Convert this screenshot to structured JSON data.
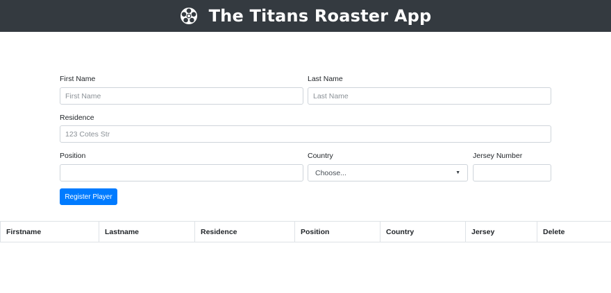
{
  "navbar": {
    "title": "The Titans Roaster App",
    "logo_icon": "soccer-ball-icon"
  },
  "form": {
    "first_name": {
      "label": "First Name",
      "placeholder": "First Name",
      "value": ""
    },
    "last_name": {
      "label": "Last Name",
      "placeholder": "Last Name",
      "value": ""
    },
    "residence": {
      "label": "Residence",
      "placeholder": "123 Cotes Str",
      "value": ""
    },
    "position": {
      "label": "Position",
      "placeholder": "",
      "value": ""
    },
    "country": {
      "label": "Country",
      "selected": "Choose..."
    },
    "jersey": {
      "label": "Jersey Number",
      "placeholder": "",
      "value": ""
    },
    "submit_label": "Register Player"
  },
  "table": {
    "columns": [
      "Firstname",
      "Lastname",
      "Residence",
      "Position",
      "Country",
      "Jersey",
      "Delete"
    ],
    "rows": []
  },
  "colors": {
    "navbar_bg": "#343a40",
    "primary": "#007bff"
  }
}
